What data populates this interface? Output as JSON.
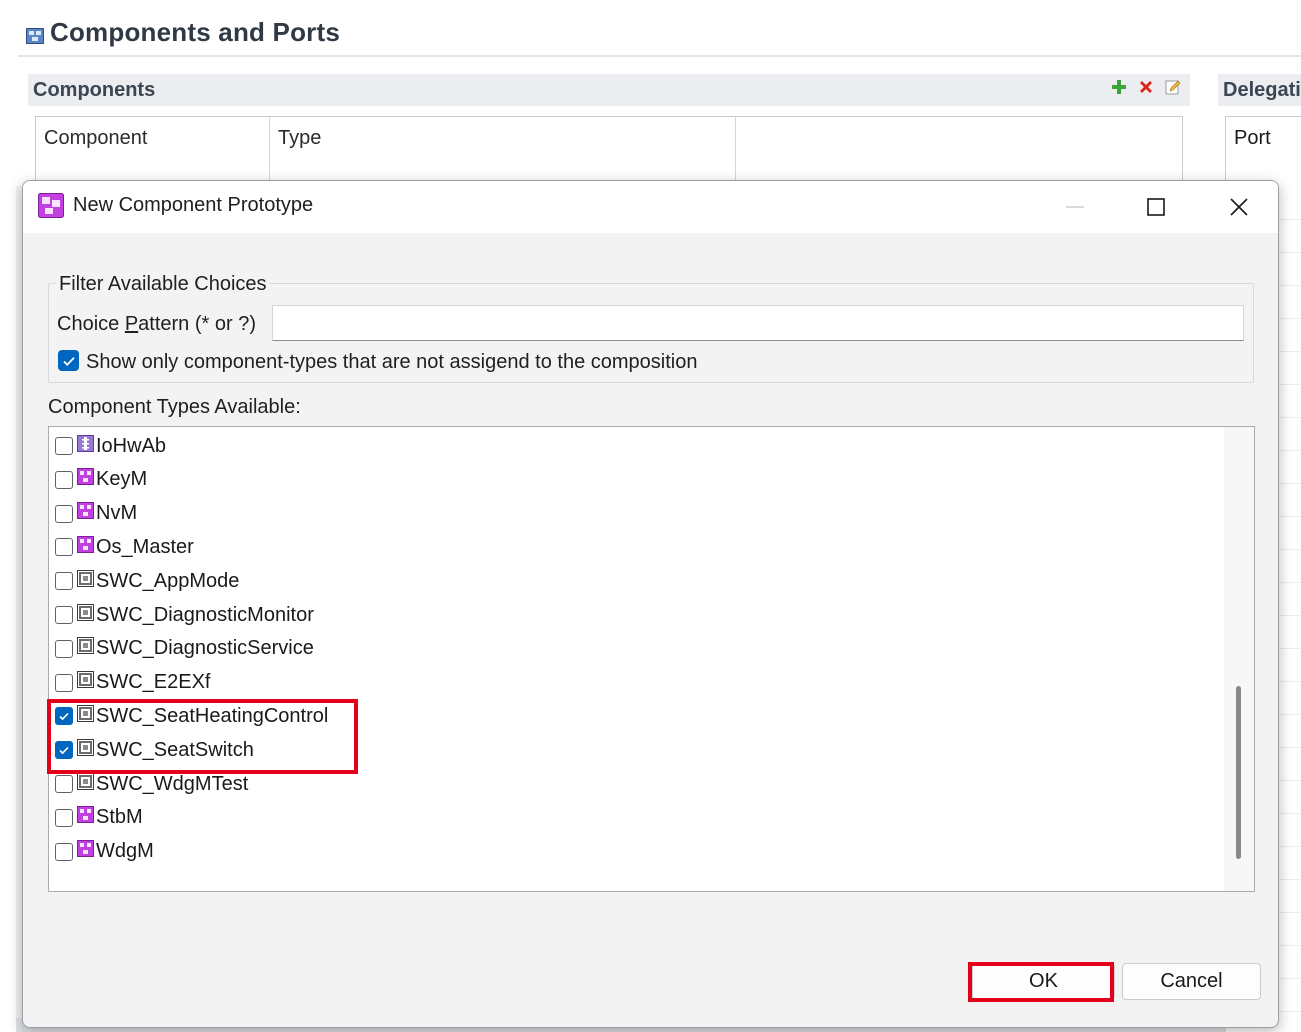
{
  "editor": {
    "page_title": "Components and Ports",
    "components_section": {
      "title": "Components",
      "columns": [
        "Component",
        "Type",
        ""
      ]
    },
    "delegation_section": {
      "title": "Delegation Ports",
      "columns": [
        "Port"
      ]
    },
    "section_actions": [
      "add-icon",
      "delete-icon",
      "edit-icon"
    ]
  },
  "dialog": {
    "title": "New Component Prototype",
    "filter": {
      "group_label": "Filter Available Choices",
      "pattern_label_prefix": "Choice ",
      "pattern_label_accel": "P",
      "pattern_label_suffix": "attern (* or ?)",
      "pattern_value": "",
      "show_only_label": "Show only component-types that are not assigend to the composition",
      "show_only_checked": true
    },
    "types_label": "Component Types Available:",
    "types": [
      {
        "label": "IoHwAb",
        "checked": false,
        "icon": "iohwab-module-icon"
      },
      {
        "label": "KeyM",
        "checked": false,
        "icon": "bsw-module-icon"
      },
      {
        "label": "NvM",
        "checked": false,
        "icon": "bsw-module-icon"
      },
      {
        "label": "Os_Master",
        "checked": false,
        "icon": "bsw-module-icon"
      },
      {
        "label": "SWC_AppMode",
        "checked": false,
        "icon": "swc-type-icon"
      },
      {
        "label": "SWC_DiagnosticMonitor",
        "checked": false,
        "icon": "swc-type-icon"
      },
      {
        "label": "SWC_DiagnosticService",
        "checked": false,
        "icon": "swc-type-icon"
      },
      {
        "label": "SWC_E2EXf",
        "checked": false,
        "icon": "swc-type-icon"
      },
      {
        "label": "SWC_SeatHeatingControl",
        "checked": true,
        "icon": "swc-type-icon"
      },
      {
        "label": "SWC_SeatSwitch",
        "checked": true,
        "icon": "swc-type-icon"
      },
      {
        "label": "SWC_WdgMTest",
        "checked": false,
        "icon": "swc-type-icon"
      },
      {
        "label": "StbM",
        "checked": false,
        "icon": "bsw-module-icon"
      },
      {
        "label": "WdgM",
        "checked": false,
        "icon": "bsw-module-icon"
      }
    ],
    "ok_label": "OK",
    "cancel_label": "Cancel"
  },
  "colors": {
    "highlight": "#e2001a",
    "accent": "#0067c0",
    "bsw_icon": "#c23fe0"
  }
}
